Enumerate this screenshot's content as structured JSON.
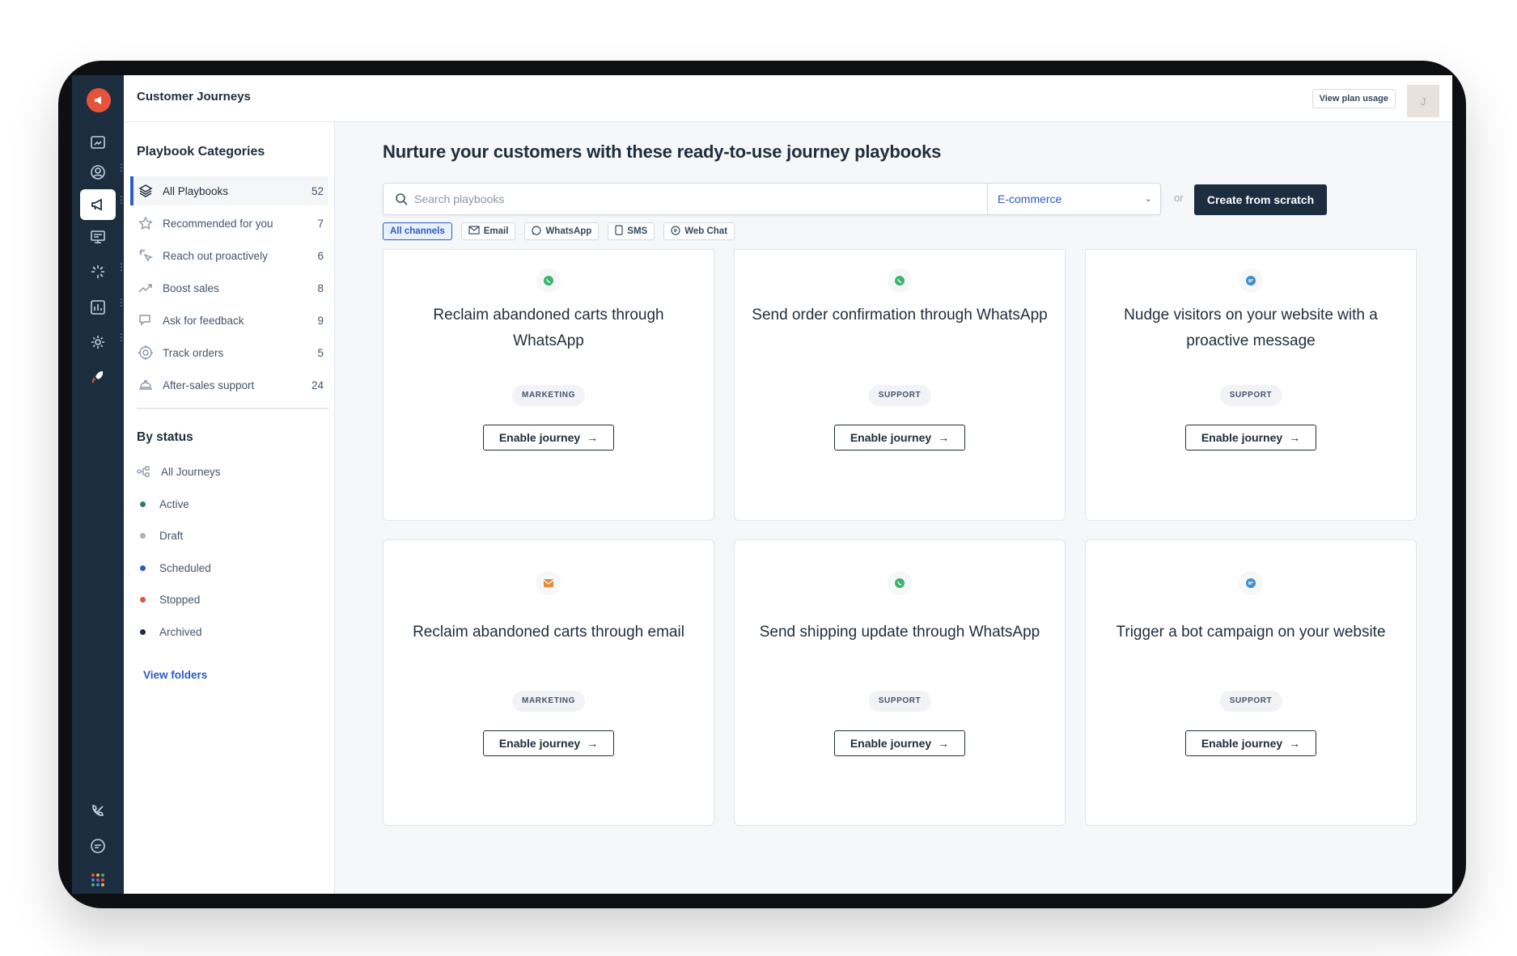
{
  "app": {
    "title": "Customer Journeys",
    "plan_button": "View plan usage",
    "avatar_initial": "J"
  },
  "panel": {
    "categories_heading": "Playbook Categories",
    "categories": [
      {
        "label": "All Playbooks",
        "count": "52",
        "icon": "layers-icon",
        "active": true
      },
      {
        "label": "Recommended for you",
        "count": "7",
        "icon": "star-icon"
      },
      {
        "label": "Reach out proactively",
        "count": "6",
        "icon": "sparkle-cursor-icon"
      },
      {
        "label": "Boost sales",
        "count": "8",
        "icon": "trend-up-icon"
      },
      {
        "label": "Ask for feedback",
        "count": "9",
        "icon": "feedback-icon"
      },
      {
        "label": "Track orders",
        "count": "5",
        "icon": "target-icon"
      },
      {
        "label": "After-sales support",
        "count": "24",
        "icon": "service-bell-icon"
      }
    ],
    "status_heading": "By status",
    "statuses": [
      {
        "label": "All Journeys",
        "icon": "journey-flow-icon"
      },
      {
        "label": "Active",
        "color": "#2e7d5b"
      },
      {
        "label": "Draft",
        "color": "#a7b1bc"
      },
      {
        "label": "Scheduled",
        "color": "#2c5cc5"
      },
      {
        "label": "Stopped",
        "color": "#d9534f"
      },
      {
        "label": "Archived",
        "color": "#1f2d3d"
      }
    ],
    "folders_link": "View folders"
  },
  "main": {
    "heading": "Nurture your customers with these ready-to-use journey playbooks",
    "search_placeholder": "Search playbooks",
    "industry_select": "E-commerce",
    "or_text": "or",
    "create_button": "Create from scratch",
    "channels": [
      {
        "label": "All channels",
        "icon": "",
        "active": true
      },
      {
        "label": "Email",
        "icon": "email-icon"
      },
      {
        "label": "WhatsApp",
        "icon": "whatsapp-icon"
      },
      {
        "label": "SMS",
        "icon": "phone-icon"
      },
      {
        "label": "Web Chat",
        "icon": "chat-icon"
      }
    ],
    "cards": [
      {
        "title": "Reclaim abandoned carts through WhatsApp",
        "tag": "MARKETING",
        "channel_icon": "whatsapp-icon",
        "button": "Enable journey"
      },
      {
        "title": "Send order confirmation through WhatsApp",
        "tag": "SUPPORT",
        "channel_icon": "whatsapp-icon",
        "button": "Enable journey"
      },
      {
        "title": "Nudge visitors on your website with a proactive message",
        "tag": "SUPPORT",
        "channel_icon": "web-chat-icon",
        "button": "Enable journey"
      },
      {
        "title": "Reclaim abandoned carts through email",
        "tag": "MARKETING",
        "channel_icon": "email-icon",
        "button": "Enable journey"
      },
      {
        "title": "Send shipping update through WhatsApp",
        "tag": "SUPPORT",
        "channel_icon": "whatsapp-icon",
        "button": "Enable journey"
      },
      {
        "title": "Trigger a bot campaign on your website",
        "tag": "SUPPORT",
        "channel_icon": "web-chat-icon",
        "button": "Enable journey"
      }
    ]
  },
  "colors": {
    "accent": "#2c5cc5",
    "rail": "#1c2d40",
    "brand": "#e5533a",
    "whatsapp": "#3cb46e",
    "email": "#e58a3a",
    "chat": "#3e8ed0"
  }
}
